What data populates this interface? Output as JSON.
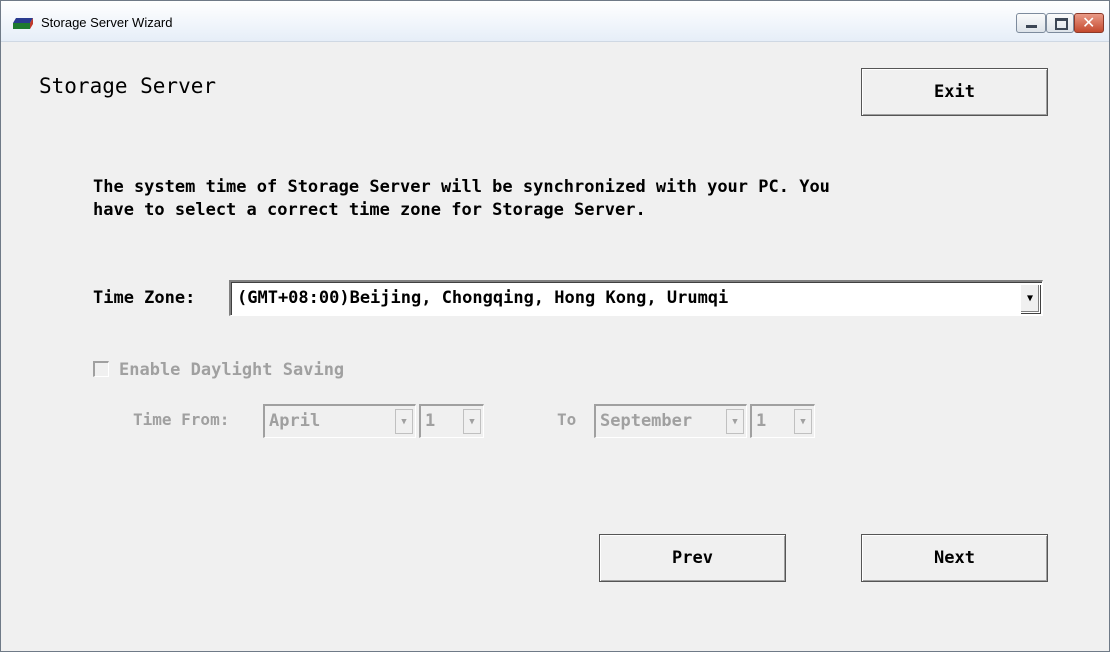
{
  "window": {
    "title": "Storage Server Wizard",
    "icon": "drive-icon"
  },
  "page": {
    "heading": "Storage Server",
    "description_lines": [
      "The system time of Storage Server will be synchronized with your PC. You",
      "have to select a correct time zone for Storage Server."
    ]
  },
  "buttons": {
    "exit": "Exit",
    "prev": "Prev",
    "next": "Next"
  },
  "time_zone": {
    "label": "Time Zone:",
    "value": "(GMT+08:00)Beijing, Chongqing, Hong Kong, Urumqi"
  },
  "daylight_saving": {
    "label": "Enable Daylight Saving",
    "checked": false,
    "time_from_label": "Time From:",
    "from_month": "April",
    "from_day": "1",
    "to_label": "To",
    "to_month": "September",
    "to_day": "1"
  }
}
